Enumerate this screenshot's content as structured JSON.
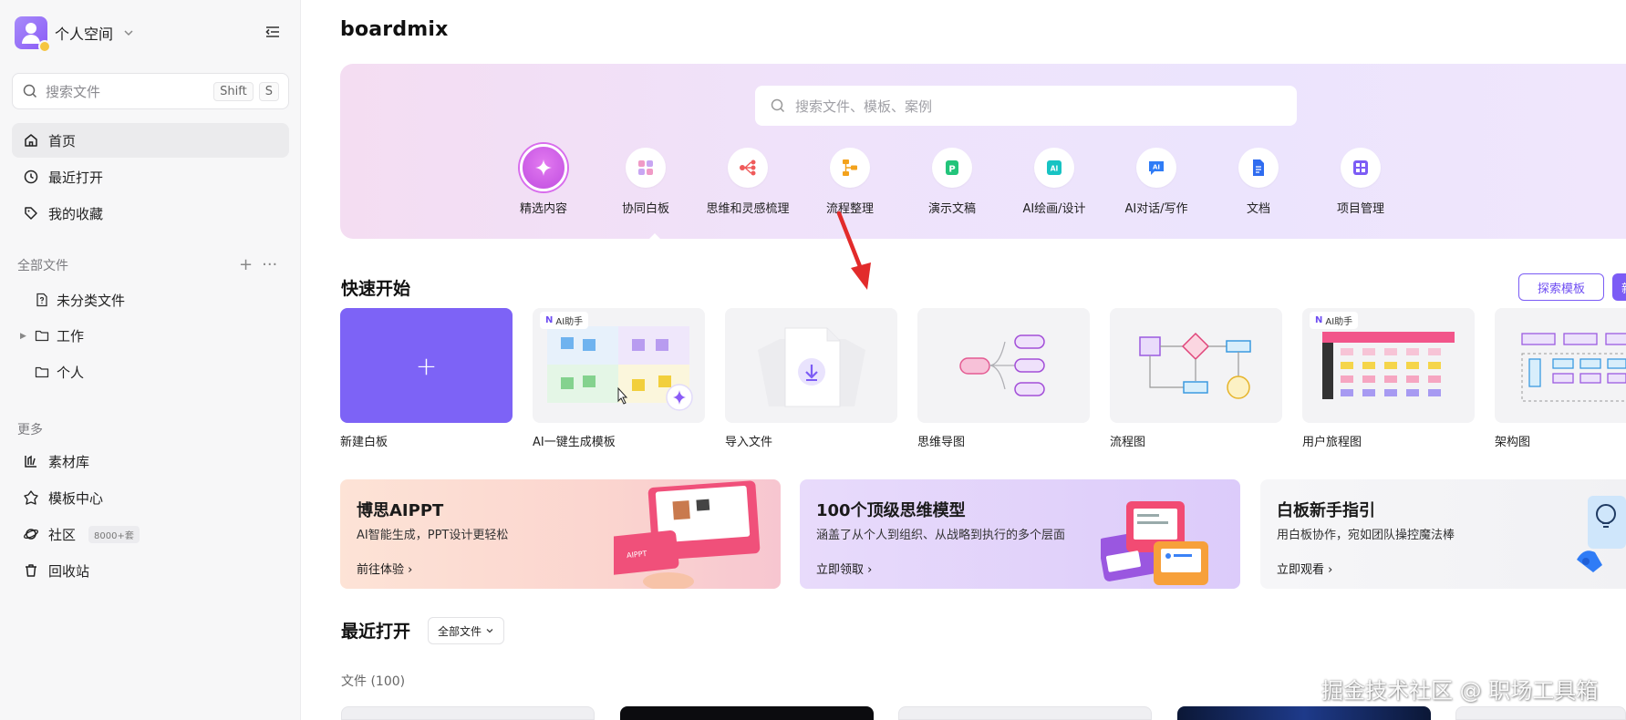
{
  "sidebar": {
    "workspace_name": "个人空间",
    "search": {
      "placeholder": "搜索文件",
      "shortcut_1": "Shift",
      "shortcut_2": "S"
    },
    "nav": [
      {
        "label": "首页",
        "icon": "home-icon"
      },
      {
        "label": "最近打开",
        "icon": "clock-icon"
      },
      {
        "label": "我的收藏",
        "icon": "tag-icon"
      }
    ],
    "all_files_label": "全部文件",
    "folders": [
      {
        "label": "未分类文件",
        "icon": "file-question-icon"
      },
      {
        "label": "工作",
        "icon": "folder-icon"
      },
      {
        "label": "个人",
        "icon": "folder-icon"
      }
    ],
    "more_label": "更多",
    "more_items": [
      {
        "label": "素材库",
        "icon": "library-icon"
      },
      {
        "label": "模板中心",
        "icon": "template-icon"
      },
      {
        "label": "社区",
        "icon": "planet-icon",
        "badge": "8000+套"
      },
      {
        "label": "回收站",
        "icon": "trash-icon"
      }
    ]
  },
  "main": {
    "brand": "boardmix",
    "hero_search_placeholder": "搜索文件、模板、案例",
    "categories": [
      {
        "label": "精选内容",
        "color": "#c94ee3"
      },
      {
        "label": "协同白板",
        "color": "#e66fa9"
      },
      {
        "label": "思维和灵感梳理",
        "color": "#ef5a5a"
      },
      {
        "label": "流程整理",
        "color": "#f3a21c"
      },
      {
        "label": "演示文稿",
        "color": "#22c47a"
      },
      {
        "label": "AI绘画/设计",
        "color": "#17c3c3"
      },
      {
        "label": "AI对话/写作",
        "color": "#2f7cf6"
      },
      {
        "label": "文档",
        "color": "#2f6cf0"
      },
      {
        "label": "项目管理",
        "color": "#7c5cf5"
      }
    ],
    "quick_start_title": "快速开始",
    "explore_templates": "探索模板",
    "new_button": "新",
    "ai_tag": "AI助手",
    "templates": [
      {
        "label": "新建白板"
      },
      {
        "label": "AI一键生成模板"
      },
      {
        "label": "导入文件"
      },
      {
        "label": "思维导图"
      },
      {
        "label": "流程图"
      },
      {
        "label": "用户旅程图"
      },
      {
        "label": "架构图"
      }
    ],
    "banners": [
      {
        "title": "博思AIPPT",
        "subtitle": "AI智能生成，PPT设计更轻松",
        "link": "前往体验",
        "card_text": "AIPPT"
      },
      {
        "title": "100个顶级思维模型",
        "subtitle": "涵盖了从个人到组织、从战略到执行的多个层面",
        "link": "立即领取"
      },
      {
        "title": "白板新手指引",
        "subtitle": "用白板协作，宛如团队操控魔法棒",
        "link": "立即观看"
      }
    ],
    "recent_title": "最近打开",
    "filter_label": "全部文件",
    "files_count": "文件 (100)"
  },
  "watermark": "掘金技术社区 @ 职场工具箱",
  "colors": {
    "accent": "#7c5cf5",
    "hero_bg": "#efe3fb",
    "sidebar_bg": "#f7f7f8",
    "arrow": "#e22b2b"
  }
}
